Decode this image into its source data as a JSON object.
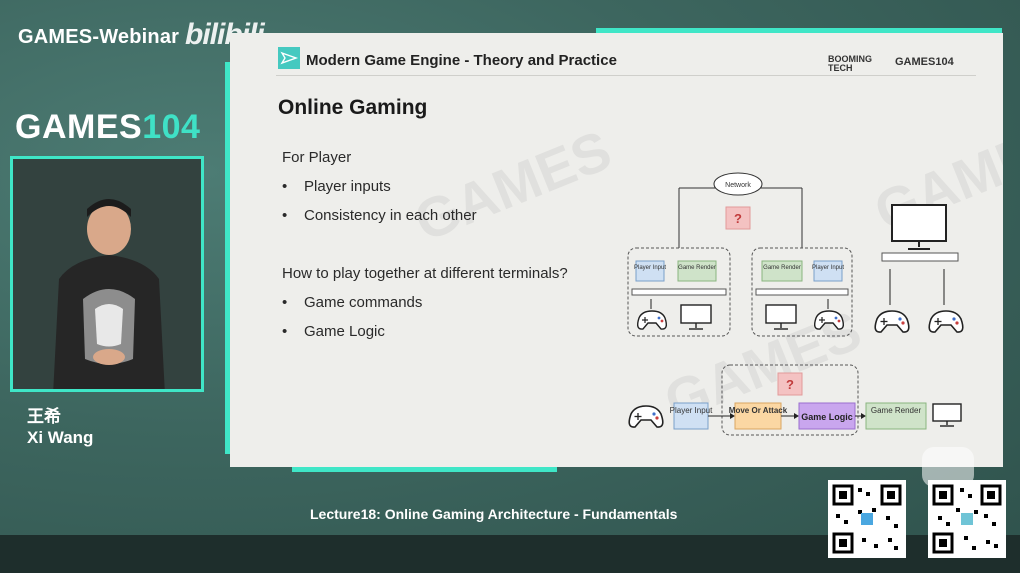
{
  "broadcast": {
    "webinar_title": "GAMES-Webinar",
    "platform_logo": "bilibili",
    "course_logo_prefix": "GAMES",
    "course_logo_number": "104",
    "speaker_name_cn": "王希",
    "speaker_name_en": "Xi Wang",
    "lecture_caption": "Lecture18: Online Gaming Architecture - Fundamentals"
  },
  "slide": {
    "header_title": "Modern Game Engine - Theory and Practice",
    "logo_booming_line1": "BOOMING",
    "logo_booming_line2": "TECH",
    "logo_games": "GAMES104",
    "title": "Online Gaming",
    "for_player_heading": "For Player",
    "for_player_bullets": [
      "Player inputs",
      "Consistency in each other"
    ],
    "question_heading": "How to play together at different terminals?",
    "question_bullets": [
      "Game commands",
      "Game Logic"
    ],
    "diagram": {
      "network_label": "Network",
      "unknown_mark": "?",
      "left_box": {
        "first": "Player Input",
        "second": "Game Render"
      },
      "right_box": {
        "first": "Game Render",
        "second": "Player Input"
      },
      "flow": {
        "player_input": "Player Input",
        "move_attack": "Move Or Attack",
        "game_logic": "Game Logic",
        "game_render": "Game Render"
      }
    }
  },
  "colors": {
    "accent": "#3fe6c7",
    "input_box": "#cfe0f3",
    "render_box": "#cfe3c9",
    "move_box": "#fbd7a3",
    "logic_box": "#c9a6ee",
    "question_box": "#f4c2c2"
  },
  "icons": [
    "gamepad-icon",
    "monitor-icon",
    "cloud-icon",
    "bilibili-tv-icon",
    "qr-code-icon"
  ]
}
